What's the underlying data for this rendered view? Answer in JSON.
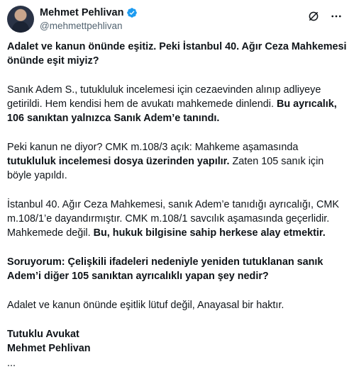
{
  "header": {
    "display_name": "Mehmet Pehlivan",
    "handle": "@mehmettpehlivan",
    "verified_color": "#1d9bf0"
  },
  "icons": {
    "avatar": "profile-photo",
    "verified": "verified-badge-icon",
    "grok": "grok-icon",
    "more": "more-icon"
  },
  "tweet": {
    "p1": "Adalet ve kanun önünde eşitiz. Peki İstanbul 40. Ağır Ceza Mahkemesi önünde eşit miyiz?",
    "p2_a": "Sanık Adem S., tutukluluk incelemesi için cezaevinden alınıp adliyeye getirildi. Hem kendisi hem de avukatı mahkemede dinlendi. ",
    "p2_b": "Bu ayrıcalık, 106 sanıktan yalnızca Sanık Adem’e tanındı.",
    "p3_a": "Peki kanun ne diyor? CMK m.108/3 açık: Mahkeme aşamasında ",
    "p3_b": "tutukluluk incelemesi dosya üzerinden yapılır.",
    "p3_c": " Zaten 105 sanık için böyle yapıldı.",
    "p4_a": "İstanbul 40. Ağır Ceza Mahkemesi, sanık Adem’e tanıdığı ayrıcalığı, CMK m.108/1’e dayandırmıştır. CMK m.108/1 savcılık aşamasında geçerlidir. Mahkemede değil. ",
    "p4_b": "Bu, hukuk bilgisine sahip herkese alay etmektir.",
    "p5": "Soruyorum: Çelişkili ifadeleri nedeniyle yeniden tutuklanan sanık Adem’i diğer 105 sanıktan ayrıcalıklı yapan şey nedir?",
    "p6": "Adalet ve kanun önünde eşitlik lütuf değil, Anayasal bir haktır.",
    "sig1": "Tutuklu Avukat",
    "sig2": "Mehmet Pehlivan",
    "cut": "..."
  }
}
